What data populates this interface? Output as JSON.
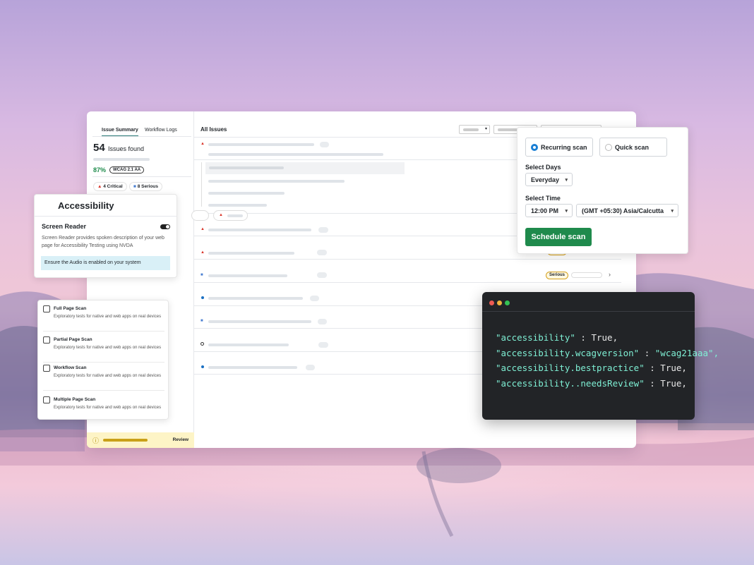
{
  "main": {
    "tabs": [
      "Issue Summary",
      "Workflow Logs"
    ],
    "issues_count": "54",
    "issues_label": "Issues found",
    "score": "87%",
    "wcag_badge": "WCAG 2.1 AA",
    "critical": "4 Critical",
    "serious": "8 Serious",
    "all_issues": "All Issues",
    "review": "Review",
    "row_badge": "Serious"
  },
  "accessibility": {
    "title": "Accessibility",
    "screen_reader_title": "Screen Reader",
    "screen_reader_desc": "Screen Reader provides spoken description of your web page for Accessibility Testing using NVDA",
    "notice": "Ensure the Audio is enabled on your system",
    "toggle_on": true
  },
  "scans": [
    {
      "title": "Full Page Scan",
      "desc": "Exploratory tests for native and web apps on real devices"
    },
    {
      "title": "Partial Page Scan",
      "desc": "Exploratory tests for native and web apps on real devices"
    },
    {
      "title": "Workflow Scan",
      "desc": "Exploratory tests for native and web apps on real devices"
    },
    {
      "title": "Multiple Page Scan",
      "desc": "Exploratory tests for native and web apps on real devices"
    }
  ],
  "schedule": {
    "recurring": "Recurring scan",
    "quick": "Quick scan",
    "days_label": "Select Days",
    "days_value": "Everyday",
    "time_label": "Select Time",
    "time_value": "12:00 PM",
    "timezone_value": "(GMT +05:30) Asia/Calcutta",
    "button": "Schedule scan",
    "selected_mode": "Recurring scan"
  },
  "code": {
    "lines": [
      {
        "key": "\"accessibility\"",
        "value": "True,"
      },
      {
        "key": "\"accessibility.wcagversion\"",
        "value": "\"wcag21aaa\","
      },
      {
        "key": "\"accessibility.bestpractice\"",
        "value": "True,"
      },
      {
        "key": "\"accessibility..needsReview\"",
        "value": "True,"
      }
    ]
  },
  "colors": {
    "accent_green": "#1f8a4c",
    "radio_blue": "#1a7fd4",
    "code_key": "#7ff0d5",
    "critical_red": "#d9362b",
    "serious_blue": "#4a7fd1"
  }
}
